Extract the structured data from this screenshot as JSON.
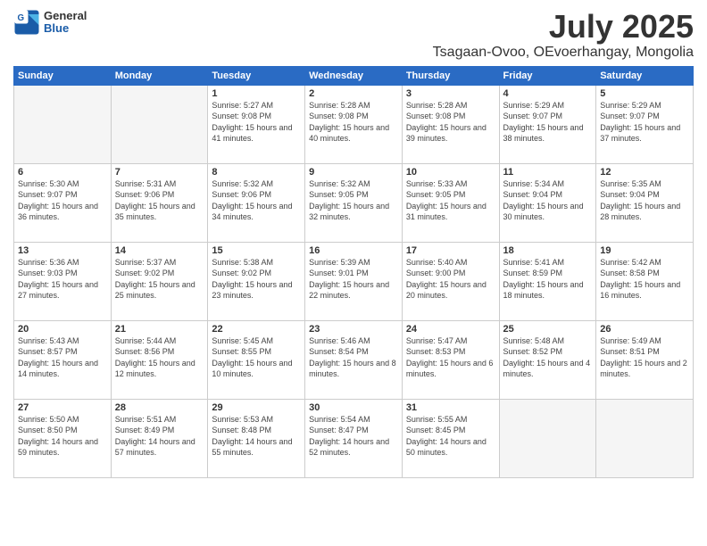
{
  "header": {
    "logo_line1": "General",
    "logo_line2": "Blue",
    "title": "July 2025",
    "subtitle": "Tsagaan-Ovoo, OEvoerhangay, Mongolia"
  },
  "weekdays": [
    "Sunday",
    "Monday",
    "Tuesday",
    "Wednesday",
    "Thursday",
    "Friday",
    "Saturday"
  ],
  "weeks": [
    [
      {
        "day": "",
        "sunrise": "",
        "sunset": "",
        "daylight": ""
      },
      {
        "day": "",
        "sunrise": "",
        "sunset": "",
        "daylight": ""
      },
      {
        "day": "1",
        "sunrise": "Sunrise: 5:27 AM",
        "sunset": "Sunset: 9:08 PM",
        "daylight": "Daylight: 15 hours and 41 minutes."
      },
      {
        "day": "2",
        "sunrise": "Sunrise: 5:28 AM",
        "sunset": "Sunset: 9:08 PM",
        "daylight": "Daylight: 15 hours and 40 minutes."
      },
      {
        "day": "3",
        "sunrise": "Sunrise: 5:28 AM",
        "sunset": "Sunset: 9:08 PM",
        "daylight": "Daylight: 15 hours and 39 minutes."
      },
      {
        "day": "4",
        "sunrise": "Sunrise: 5:29 AM",
        "sunset": "Sunset: 9:07 PM",
        "daylight": "Daylight: 15 hours and 38 minutes."
      },
      {
        "day": "5",
        "sunrise": "Sunrise: 5:29 AM",
        "sunset": "Sunset: 9:07 PM",
        "daylight": "Daylight: 15 hours and 37 minutes."
      }
    ],
    [
      {
        "day": "6",
        "sunrise": "Sunrise: 5:30 AM",
        "sunset": "Sunset: 9:07 PM",
        "daylight": "Daylight: 15 hours and 36 minutes."
      },
      {
        "day": "7",
        "sunrise": "Sunrise: 5:31 AM",
        "sunset": "Sunset: 9:06 PM",
        "daylight": "Daylight: 15 hours and 35 minutes."
      },
      {
        "day": "8",
        "sunrise": "Sunrise: 5:32 AM",
        "sunset": "Sunset: 9:06 PM",
        "daylight": "Daylight: 15 hours and 34 minutes."
      },
      {
        "day": "9",
        "sunrise": "Sunrise: 5:32 AM",
        "sunset": "Sunset: 9:05 PM",
        "daylight": "Daylight: 15 hours and 32 minutes."
      },
      {
        "day": "10",
        "sunrise": "Sunrise: 5:33 AM",
        "sunset": "Sunset: 9:05 PM",
        "daylight": "Daylight: 15 hours and 31 minutes."
      },
      {
        "day": "11",
        "sunrise": "Sunrise: 5:34 AM",
        "sunset": "Sunset: 9:04 PM",
        "daylight": "Daylight: 15 hours and 30 minutes."
      },
      {
        "day": "12",
        "sunrise": "Sunrise: 5:35 AM",
        "sunset": "Sunset: 9:04 PM",
        "daylight": "Daylight: 15 hours and 28 minutes."
      }
    ],
    [
      {
        "day": "13",
        "sunrise": "Sunrise: 5:36 AM",
        "sunset": "Sunset: 9:03 PM",
        "daylight": "Daylight: 15 hours and 27 minutes."
      },
      {
        "day": "14",
        "sunrise": "Sunrise: 5:37 AM",
        "sunset": "Sunset: 9:02 PM",
        "daylight": "Daylight: 15 hours and 25 minutes."
      },
      {
        "day": "15",
        "sunrise": "Sunrise: 5:38 AM",
        "sunset": "Sunset: 9:02 PM",
        "daylight": "Daylight: 15 hours and 23 minutes."
      },
      {
        "day": "16",
        "sunrise": "Sunrise: 5:39 AM",
        "sunset": "Sunset: 9:01 PM",
        "daylight": "Daylight: 15 hours and 22 minutes."
      },
      {
        "day": "17",
        "sunrise": "Sunrise: 5:40 AM",
        "sunset": "Sunset: 9:00 PM",
        "daylight": "Daylight: 15 hours and 20 minutes."
      },
      {
        "day": "18",
        "sunrise": "Sunrise: 5:41 AM",
        "sunset": "Sunset: 8:59 PM",
        "daylight": "Daylight: 15 hours and 18 minutes."
      },
      {
        "day": "19",
        "sunrise": "Sunrise: 5:42 AM",
        "sunset": "Sunset: 8:58 PM",
        "daylight": "Daylight: 15 hours and 16 minutes."
      }
    ],
    [
      {
        "day": "20",
        "sunrise": "Sunrise: 5:43 AM",
        "sunset": "Sunset: 8:57 PM",
        "daylight": "Daylight: 15 hours and 14 minutes."
      },
      {
        "day": "21",
        "sunrise": "Sunrise: 5:44 AM",
        "sunset": "Sunset: 8:56 PM",
        "daylight": "Daylight: 15 hours and 12 minutes."
      },
      {
        "day": "22",
        "sunrise": "Sunrise: 5:45 AM",
        "sunset": "Sunset: 8:55 PM",
        "daylight": "Daylight: 15 hours and 10 minutes."
      },
      {
        "day": "23",
        "sunrise": "Sunrise: 5:46 AM",
        "sunset": "Sunset: 8:54 PM",
        "daylight": "Daylight: 15 hours and 8 minutes."
      },
      {
        "day": "24",
        "sunrise": "Sunrise: 5:47 AM",
        "sunset": "Sunset: 8:53 PM",
        "daylight": "Daylight: 15 hours and 6 minutes."
      },
      {
        "day": "25",
        "sunrise": "Sunrise: 5:48 AM",
        "sunset": "Sunset: 8:52 PM",
        "daylight": "Daylight: 15 hours and 4 minutes."
      },
      {
        "day": "26",
        "sunrise": "Sunrise: 5:49 AM",
        "sunset": "Sunset: 8:51 PM",
        "daylight": "Daylight: 15 hours and 2 minutes."
      }
    ],
    [
      {
        "day": "27",
        "sunrise": "Sunrise: 5:50 AM",
        "sunset": "Sunset: 8:50 PM",
        "daylight": "Daylight: 14 hours and 59 minutes."
      },
      {
        "day": "28",
        "sunrise": "Sunrise: 5:51 AM",
        "sunset": "Sunset: 8:49 PM",
        "daylight": "Daylight: 14 hours and 57 minutes."
      },
      {
        "day": "29",
        "sunrise": "Sunrise: 5:53 AM",
        "sunset": "Sunset: 8:48 PM",
        "daylight": "Daylight: 14 hours and 55 minutes."
      },
      {
        "day": "30",
        "sunrise": "Sunrise: 5:54 AM",
        "sunset": "Sunset: 8:47 PM",
        "daylight": "Daylight: 14 hours and 52 minutes."
      },
      {
        "day": "31",
        "sunrise": "Sunrise: 5:55 AM",
        "sunset": "Sunset: 8:45 PM",
        "daylight": "Daylight: 14 hours and 50 minutes."
      },
      {
        "day": "",
        "sunrise": "",
        "sunset": "",
        "daylight": ""
      },
      {
        "day": "",
        "sunrise": "",
        "sunset": "",
        "daylight": ""
      }
    ]
  ]
}
